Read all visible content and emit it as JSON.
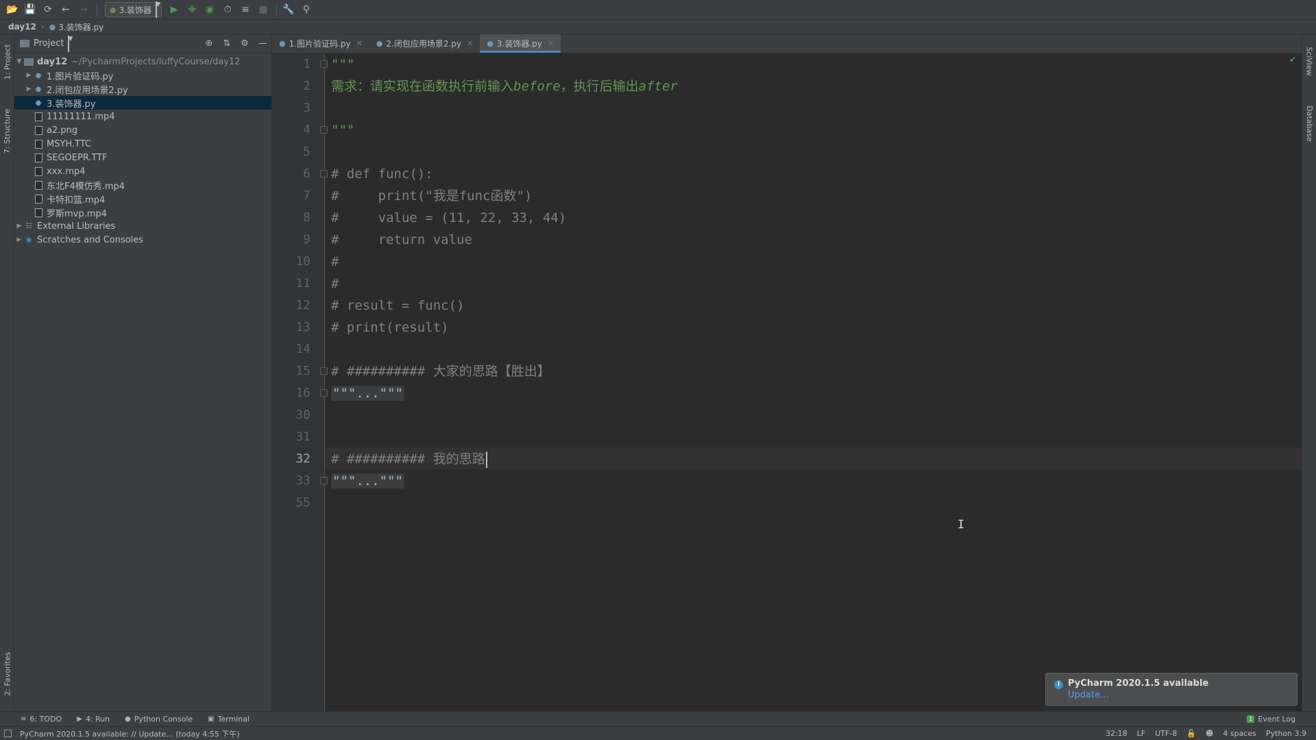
{
  "toolbar": {
    "run_config": "3.装饰器"
  },
  "breadcrumb": {
    "project": "day12",
    "file": "3.装饰器.py"
  },
  "left_stripe": {
    "project_tab": "1: Project",
    "structure_tab": "7: Structure",
    "favorites_tab": "2: Favorites"
  },
  "right_stripe": {
    "sciview_tab": "SciView",
    "database_tab": "Database"
  },
  "project_panel": {
    "title": "Project",
    "root_name": "day12",
    "root_path": "~/PycharmProjects/luffyCourse/day12",
    "items": [
      {
        "label": "1.图片验证码.py"
      },
      {
        "label": "2.闭包应用场景2.py"
      },
      {
        "label": "3.装饰器.py"
      },
      {
        "label": "11111111.mp4"
      },
      {
        "label": "a2.png"
      },
      {
        "label": "MSYH.TTC"
      },
      {
        "label": "SEGOEPR.TTF"
      },
      {
        "label": "xxx.mp4"
      },
      {
        "label": "东北F4模仿秀.mp4"
      },
      {
        "label": "卡特扣篮.mp4"
      },
      {
        "label": "罗斯mvp.mp4"
      }
    ],
    "external_libraries": "External Libraries",
    "scratches": "Scratches and Consoles"
  },
  "editor_tabs": [
    {
      "label": "1.图片验证码.py"
    },
    {
      "label": "2.闭包应用场景2.py"
    },
    {
      "label": "3.装饰器.py"
    }
  ],
  "editor": {
    "line_numbers": [
      "1",
      "2",
      "3",
      "4",
      "5",
      "6",
      "7",
      "8",
      "9",
      "10",
      "11",
      "12",
      "13",
      "14",
      "15",
      "16",
      "30",
      "31",
      "32",
      "33",
      "55"
    ],
    "current_line": "32",
    "lines": {
      "l1": "\"\"\"",
      "l2_prefix": "需求：请实现在函数执行前输入",
      "l2_before": "before",
      "l2_middle": "，执行后输出",
      "l2_after": "after",
      "l4": "\"\"\"",
      "l6": "# def func():",
      "l7": "#     print(\"我是func函数\")",
      "l8": "#     value = (11, 22, 33, 44)",
      "l9": "#     return value",
      "l10": "#",
      "l11": "#",
      "l12": "# result = func()",
      "l13": "# print(result)",
      "l15": "# ########## 大家的思路【胜出】",
      "l16": "\"\"\"...\"\"\"",
      "l32": "# ########## 我的思路",
      "l33": "\"\"\"...\"\"\""
    }
  },
  "notification": {
    "title": "PyCharm 2020.1.5 available",
    "link": "Update..."
  },
  "tool_windows": {
    "todo": "6: TODO",
    "run": "4: Run",
    "python_console": "Python Console",
    "terminal": "Terminal",
    "event_log": "Event Log"
  },
  "status_bar": {
    "message": "PyCharm 2020.1.5 available: // Update... (today 4:55 下午)",
    "position": "32:18",
    "line_sep": "LF",
    "encoding": "UTF-8",
    "indent": "4 spaces",
    "interpreter": "Python 3.9"
  }
}
